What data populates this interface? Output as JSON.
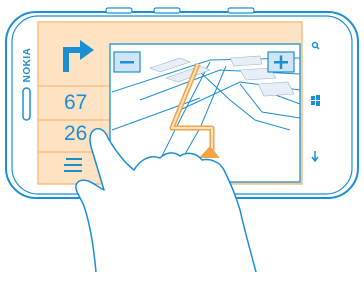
{
  "device": {
    "brand": "NOKIA",
    "accent_color": "#1b8fd4",
    "panel_color": "#fde2c3"
  },
  "navigation": {
    "turn_direction": "turn-right-arrow-icon",
    "distance_value": "67",
    "second_value": "26",
    "menu_icon": "menu-icon"
  },
  "map": {
    "zoom_out_label": "−",
    "zoom_in_label": "+",
    "position_marker": "position-arrow-icon"
  },
  "hardware_buttons": {
    "search": "search-icon",
    "start": "windows-start-icon",
    "back": "back-arrow-icon"
  },
  "gesture": {
    "icon": "hand-tap-gesture-icon"
  }
}
